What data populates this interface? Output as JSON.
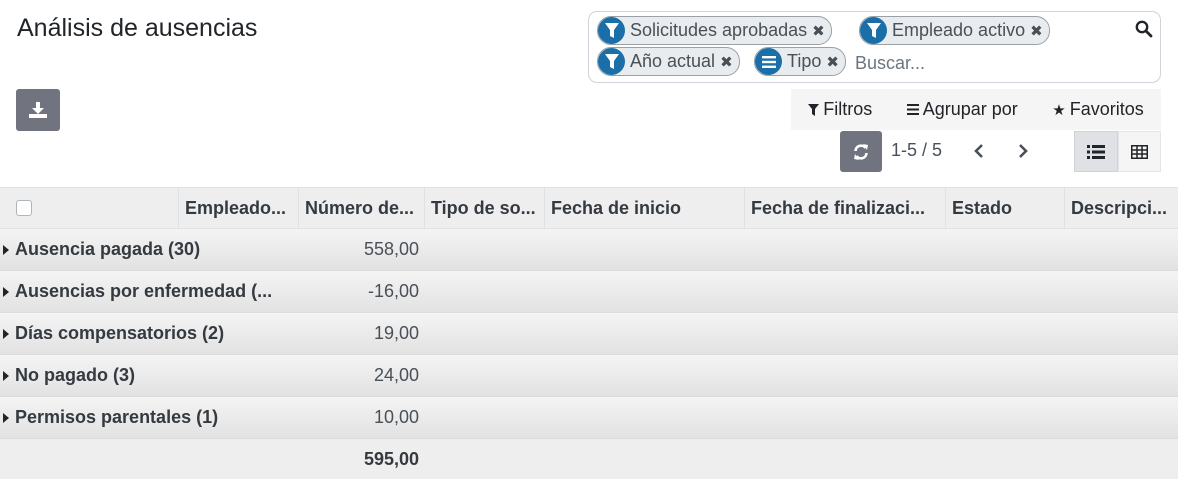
{
  "page": {
    "title": "Análisis de ausencias"
  },
  "search": {
    "facets": [
      {
        "label": "Solicitudes aprobadas",
        "icon": "filter-icon"
      },
      {
        "label": "Empleado activo",
        "icon": "filter-icon"
      },
      {
        "label": "Año actual",
        "icon": "filter-icon"
      },
      {
        "label": "Tipo",
        "icon": "group-by-icon"
      }
    ],
    "placeholder": "Buscar..."
  },
  "toolbar": {
    "filters": "Filtros",
    "group_by": "Agrupar por",
    "favorites": "Favoritos",
    "pager": "1-5 / 5"
  },
  "table": {
    "headers": [
      "Empleado...",
      "Número de...",
      "Tipo de so...",
      "Fecha de inicio",
      "Fecha de finalizaci...",
      "Estado",
      "Descripci..."
    ],
    "groups": [
      {
        "name": "Ausencia pagada (30)",
        "value": "558,00"
      },
      {
        "name": "Ausencias por enfermedad (...",
        "value": "-16,00"
      },
      {
        "name": "Días compensatorios (2)",
        "value": "19,00"
      },
      {
        "name": "No pagado (3)",
        "value": "24,00"
      },
      {
        "name": "Permisos parentales (1)",
        "value": "10,00"
      }
    ],
    "total": "595,00"
  },
  "colors": {
    "facet_icon": "#1b6fa8",
    "button_gray": "#71737e"
  }
}
